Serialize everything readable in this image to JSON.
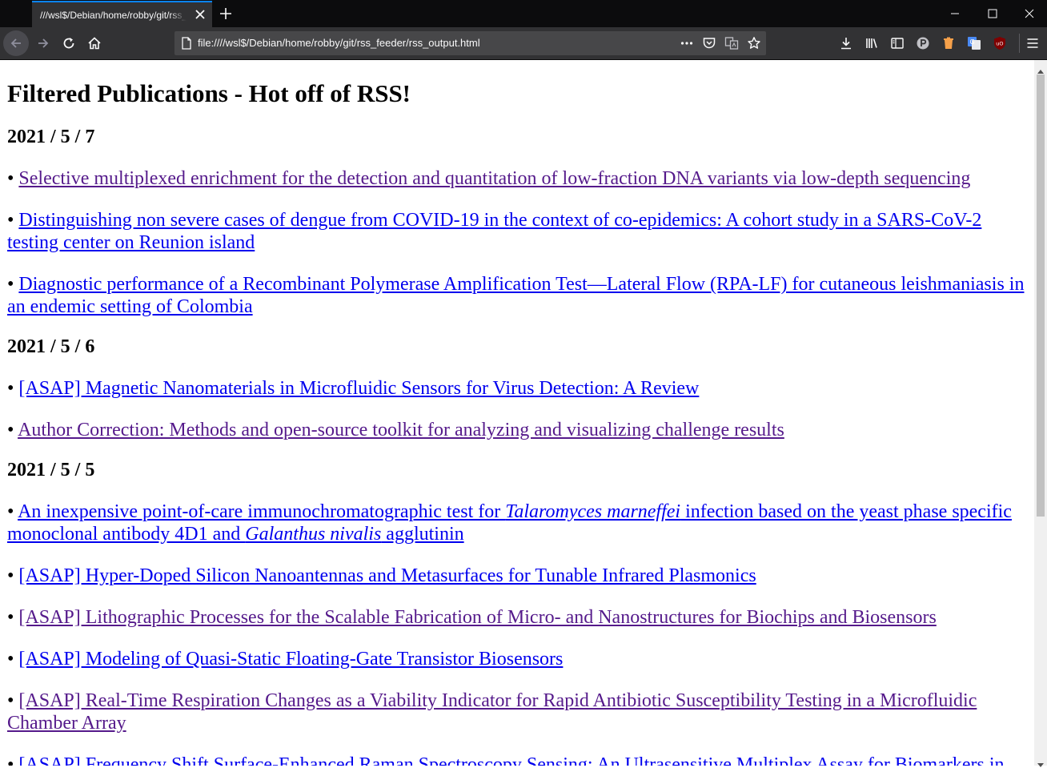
{
  "browser": {
    "tab_title": "///wsl$/Debian/home/robby/git/rss_feeder/rss_output.html",
    "url": "file:////wsl$/Debian/home/robby/git/rss_feeder/rss_output.html",
    "accent_color": "#0a84ff"
  },
  "page": {
    "heading": "Filtered Publications - Hot off of RSS!",
    "sections": [
      {
        "date": "2021 / 5 / 7",
        "items": [
          {
            "parts": [
              {
                "text": "Selective multiplexed enrichment for the detection and quantitation of low-fraction DNA variants via low-depth sequencing",
                "italic": false
              }
            ],
            "visited": true
          },
          {
            "parts": [
              {
                "text": "Distinguishing non severe cases of dengue from COVID-19 in the context of co-epidemics: A cohort study in a SARS-CoV-2 testing center on Reunion island",
                "italic": false
              }
            ],
            "visited": false
          },
          {
            "parts": [
              {
                "text": "Diagnostic performance of a Recombinant Polymerase Amplification Test—Lateral Flow (RPA-LF) for cutaneous leishmaniasis in an endemic setting of Colombia",
                "italic": false
              }
            ],
            "visited": false
          }
        ]
      },
      {
        "date": "2021 / 5 / 6",
        "items": [
          {
            "parts": [
              {
                "text": "[ASAP] Magnetic Nanomaterials in Microfluidic Sensors for Virus Detection: A Review",
                "italic": false
              }
            ],
            "visited": false
          },
          {
            "parts": [
              {
                "text": "Author Correction: Methods and open-source toolkit for analyzing and visualizing challenge results",
                "italic": false
              }
            ],
            "visited": true
          }
        ]
      },
      {
        "date": "2021 / 5 / 5",
        "items": [
          {
            "parts": [
              {
                "text": "An inexpensive point-of-care immunochromatographic test for ",
                "italic": false
              },
              {
                "text": "Talaromyces marneffei",
                "italic": true
              },
              {
                "text": " infection based on the yeast phase specific monoclonal antibody 4D1 and ",
                "italic": false
              },
              {
                "text": "Galanthus nivalis",
                "italic": true
              },
              {
                "text": " agglutinin",
                "italic": false
              }
            ],
            "visited": false
          },
          {
            "parts": [
              {
                "text": "[ASAP] Hyper-Doped Silicon Nanoantennas and Metasurfaces for Tunable Infrared Plasmonics",
                "italic": false
              }
            ],
            "visited": false
          },
          {
            "parts": [
              {
                "text": "[ASAP] Lithographic Processes for the Scalable Fabrication of Micro- and Nanostructures for Biochips and Biosensors",
                "italic": false
              }
            ],
            "visited": true
          },
          {
            "parts": [
              {
                "text": "[ASAP] Modeling of Quasi-Static Floating-Gate Transistor Biosensors",
                "italic": false
              }
            ],
            "visited": false
          },
          {
            "parts": [
              {
                "text": "[ASAP] Real-Time Respiration Changes as a Viability Indicator for Rapid Antibiotic Susceptibility Testing in a Microfluidic Chamber Array",
                "italic": false
              }
            ],
            "visited": true
          },
          {
            "parts": [
              {
                "text": "[ASAP] Frequency Shift Surface-Enhanced Raman Spectroscopy Sensing: An Ultrasensitive Multiplex Assay for Biomarkers in",
                "italic": false
              }
            ],
            "visited": false
          }
        ]
      }
    ],
    "link_color": "#0000ee",
    "visited_color": "#551a8b"
  }
}
